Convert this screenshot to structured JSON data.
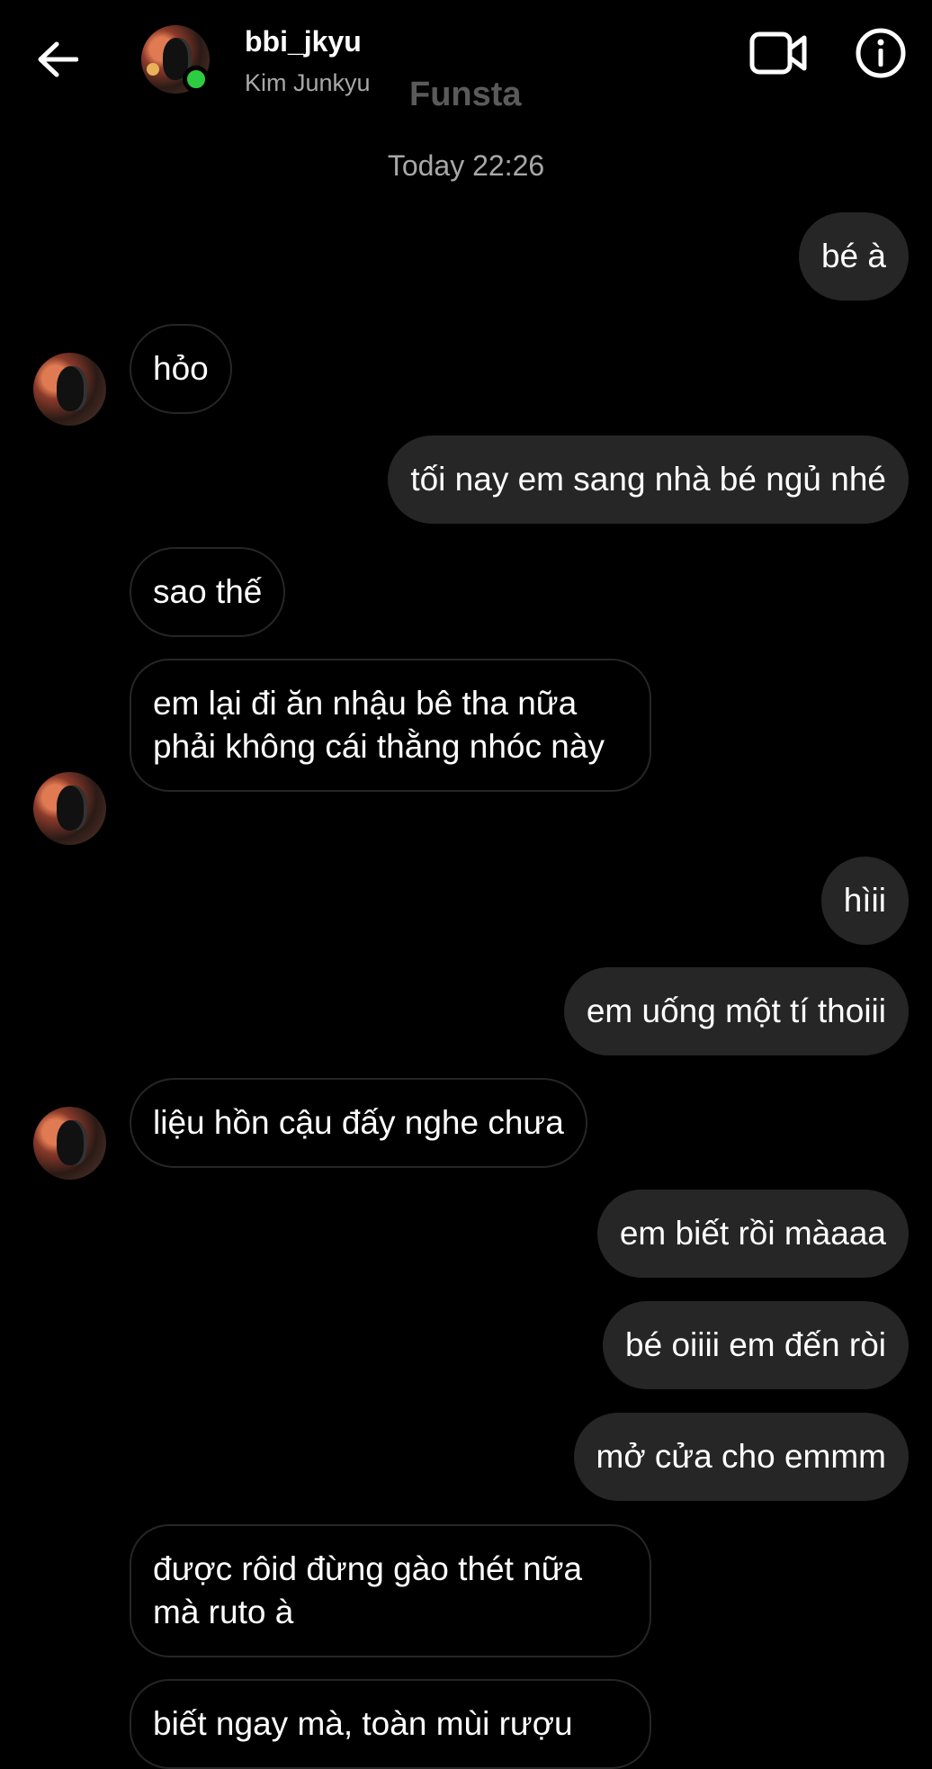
{
  "header": {
    "username": "bbi_jkyu",
    "fullname": "Kim Junkyu",
    "watermark": "Funsta",
    "online": true
  },
  "icons": {
    "back": "arrow-left-icon",
    "video": "video-camera-icon",
    "info": "info-icon",
    "online": "online-status-dot"
  },
  "colors": {
    "background": "#000000",
    "outgoing_bubble": "#262626",
    "incoming_border": "#262626",
    "online": "#2ecc40",
    "secondary_text": "#a8a8a8"
  },
  "timestamp": "Today 22:26",
  "messages": [
    {
      "dir": "out",
      "text": "bé à"
    },
    {
      "dir": "in",
      "text": "hỏo"
    },
    {
      "dir": "out",
      "text": "tối nay em sang nhà bé ngủ nhé"
    },
    {
      "dir": "in",
      "text": "sao thế"
    },
    {
      "dir": "in",
      "text": "em lại đi ăn nhậu bê tha nữa phải không cái thằng nhóc này"
    },
    {
      "dir": "out",
      "text": "hìii"
    },
    {
      "dir": "out",
      "text": "em uống một tí thoiii"
    },
    {
      "dir": "in",
      "text": "liệu hồn cậu đấy nghe chưa"
    },
    {
      "dir": "out",
      "text": "em biết rồi màaaa"
    },
    {
      "dir": "out",
      "text": "bé oiiii em đến ròi"
    },
    {
      "dir": "out",
      "text": "mở cửa cho emmm"
    },
    {
      "dir": "in",
      "text": "được rôid đừng gào thét nữa mà ruto à"
    },
    {
      "dir": "in",
      "text": "biết ngay mà, toàn mùi rượu"
    }
  ]
}
